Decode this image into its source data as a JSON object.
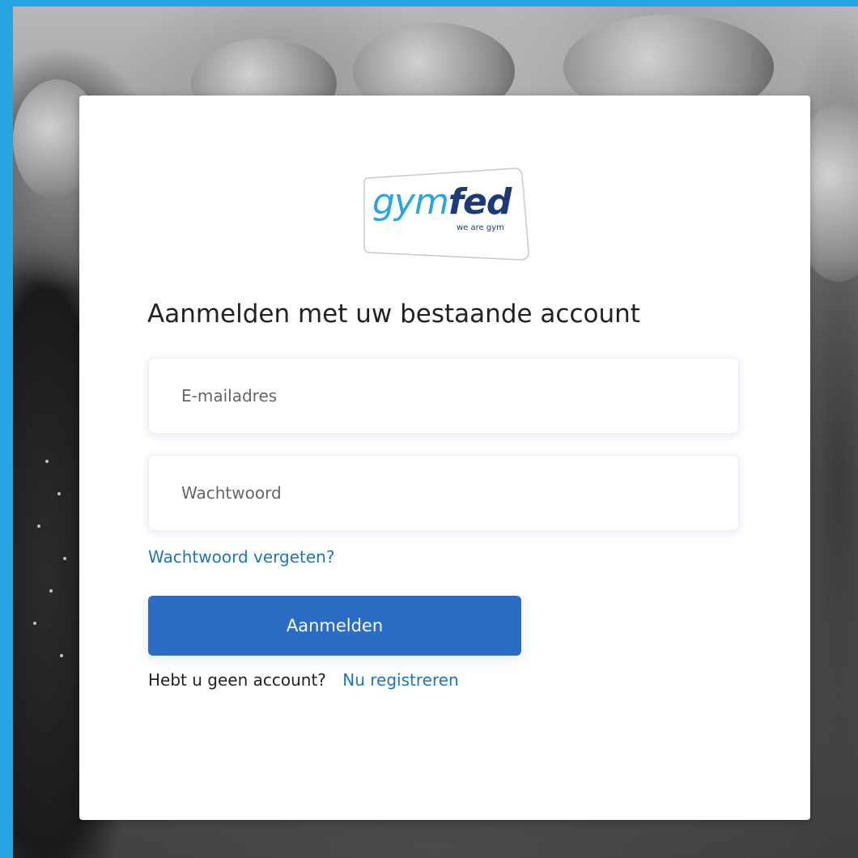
{
  "brand": {
    "logo_word_part1": "gym",
    "logo_word_part2": "fed",
    "tagline": "we are gym",
    "colors": {
      "frame": "#27a6e3",
      "logo_light": "#27a6e3",
      "logo_dark": "#1d3a78",
      "primary_button": "#2b6cc4",
      "link": "#1e74bf"
    }
  },
  "form": {
    "heading": "Aanmelden met uw bestaande account",
    "email": {
      "placeholder": "E-mailadres",
      "value": ""
    },
    "password": {
      "placeholder": "Wachtwoord",
      "value": ""
    },
    "forgot_password_label": "Wachtwoord vergeten?",
    "submit_label": "Aanmelden",
    "no_account_text": "Hebt u geen account?",
    "register_label": "Nu registreren"
  },
  "background": {
    "icon": "gymnasts-photo"
  }
}
